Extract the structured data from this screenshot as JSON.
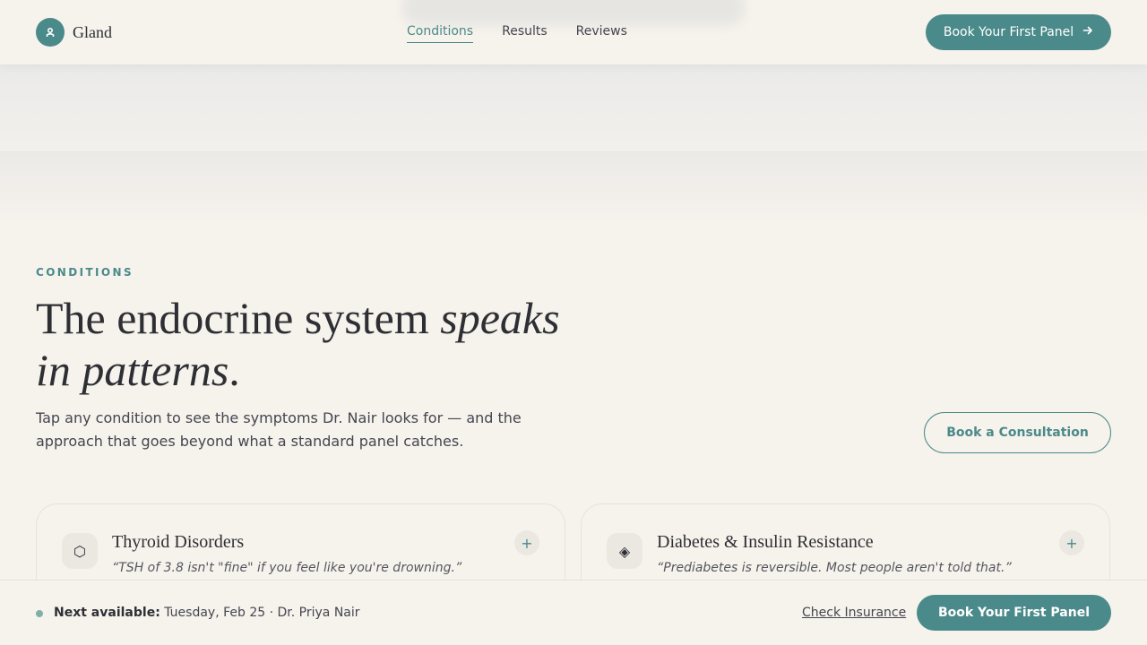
{
  "header": {
    "brand": "Gland",
    "nav": [
      {
        "label": "Conditions",
        "active": true
      },
      {
        "label": "Results",
        "active": false
      },
      {
        "label": "Reviews",
        "active": false
      }
    ],
    "cta_label": "Book Your First Panel",
    "cta_icon": "arrow-right-icon"
  },
  "section": {
    "eyebrow": "CONDITIONS",
    "headline_plain": "The endocrine system ",
    "headline_em1": "speaks",
    "headline_em2": "in patterns",
    "headline_end": ".",
    "lede": "Tap any condition to see the symptoms Dr. Nair looks for — and the approach that goes beyond what a standard panel catches.",
    "consult_label": "Book a Consultation"
  },
  "cards": [
    {
      "icon": "⬡",
      "title": "Thyroid Disorders",
      "quote": "“TSH of 3.8 isn't \"fine\" if you feel like you're drowning.”",
      "expand": "+"
    },
    {
      "icon": "◈",
      "title": "Diabetes & Insulin Resistance",
      "quote": "“Prediabetes is reversible. Most people aren't told that.”",
      "expand": "+"
    }
  ],
  "bottom_bar": {
    "availability_label": "Next available:",
    "availability_value": "Tuesday, Feb 25 · Dr. Priya Nair",
    "insurance_link": "Check Insurance",
    "cta_label": "Book Your First Panel"
  },
  "colors": {
    "accent": "#4a8a8a",
    "background": "#f6f2ec",
    "text": "#2e2f35"
  }
}
